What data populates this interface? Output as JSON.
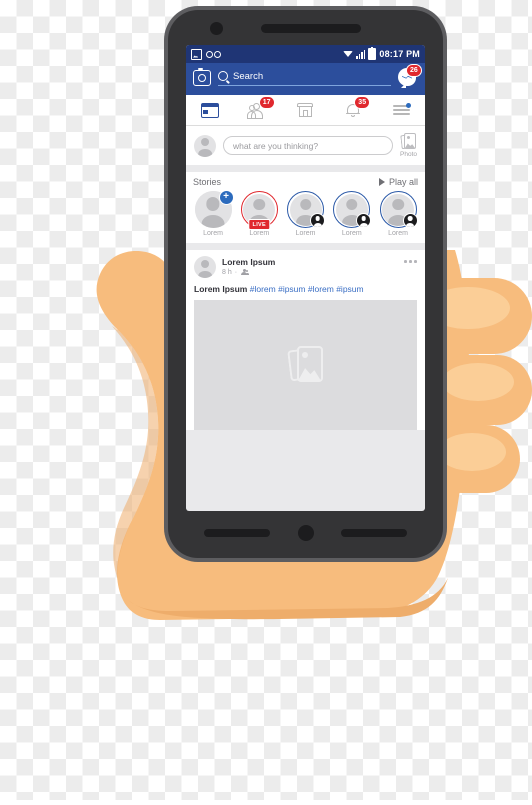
{
  "statusbar": {
    "time": "08:17 PM",
    "icons": [
      "image-icon",
      "voicemail-icon",
      "wifi-icon",
      "signal-icon",
      "battery-icon"
    ]
  },
  "header": {
    "camera_icon": "camera-icon",
    "search": {
      "icon": "search-icon",
      "placeholder": "Search",
      "value": "Search"
    },
    "messenger": {
      "icon": "messenger-icon",
      "badge": "26"
    },
    "color": "#2c4e9c"
  },
  "nav": {
    "tabs": [
      {
        "name": "newsfeed",
        "icon": "newsfeed-icon",
        "active": true,
        "badge": ""
      },
      {
        "name": "friends",
        "icon": "friends-icon",
        "active": false,
        "badge": "17"
      },
      {
        "name": "marketplace",
        "icon": "marketplace-icon",
        "active": false,
        "badge": ""
      },
      {
        "name": "notifications",
        "icon": "bell-icon",
        "active": false,
        "badge": "35"
      },
      {
        "name": "menu",
        "icon": "menu-icon",
        "active": false,
        "badge": ""
      }
    ],
    "badge_color": "#e0282e",
    "active_color": "#2c4e9c"
  },
  "composer": {
    "avatar": "avatar-icon",
    "placeholder": "what are you thinking?",
    "photo_label": "Photo",
    "photo_icon": "photo-icon"
  },
  "stories": {
    "title": "Stories",
    "play_all": "Play all",
    "play_icon": "play-icon",
    "items": [
      {
        "name": "Lorem",
        "ring": "none",
        "add": "+",
        "badge": ""
      },
      {
        "name": "Lorem",
        "ring": "red",
        "add": "",
        "badge": "LIVE"
      },
      {
        "name": "Lorem",
        "ring": "blue",
        "add": "",
        "badge": ""
      },
      {
        "name": "Lorem",
        "ring": "blue",
        "add": "",
        "badge": ""
      },
      {
        "name": "Lorem",
        "ring": "blue",
        "add": "",
        "badge": ""
      }
    ]
  },
  "post": {
    "author": "Lorem Ipsum",
    "time": "8 h",
    "separator": "·",
    "audience_icon": "friends-audience-icon",
    "menu_icon": "more-options-icon",
    "text": "Lorem Ipsum",
    "hashtags": "#lorem #ipsum #lorem #ipsum",
    "media_icon": "photo-placeholder-icon",
    "link_color": "#3b6fc4"
  },
  "device": {
    "body_color": "#343436",
    "edge_color": "#5d5d60",
    "camera": "front-camera",
    "speaker": "earpiece-speaker",
    "home_button": "home-button",
    "left_button": "left-soft-key",
    "right_button": "right-soft-key"
  },
  "hand": {
    "skin_color": "#f7bc7d",
    "shade_color": "#eead6b",
    "highlight_color": "#fcd9ac",
    "fingers": 3
  }
}
